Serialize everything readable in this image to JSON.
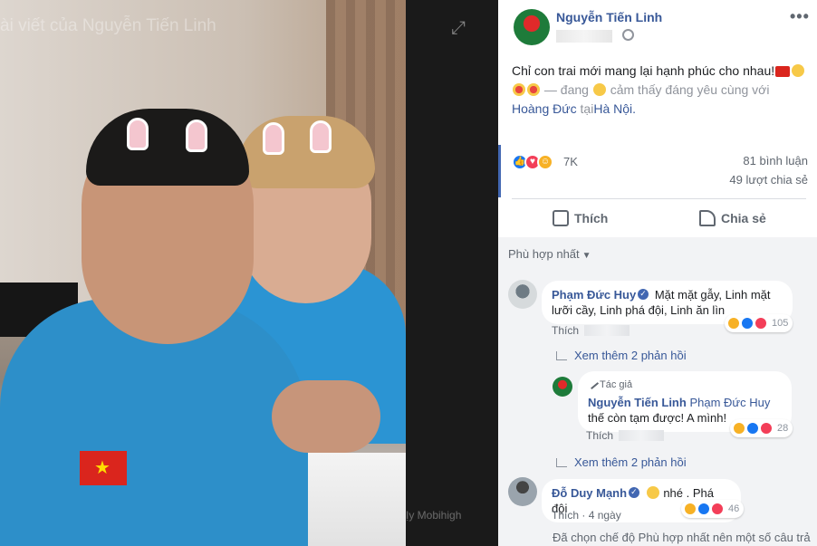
{
  "photo": {
    "overlay_title": "ài viết của Nguyễn Tiến Linh",
    "watermark": "Ịy Mobihigh"
  },
  "post": {
    "author": "Nguyễn Tiến Linh",
    "text_line1": "Chỉ con trai mới mang lại hạnh phúc cho nhau!",
    "feeling_prefix": "— đang",
    "feeling_text": "cảm thấy đáng yêu cùng với",
    "tagged_user": "Hoàng Đức",
    "location_prefix": "tại",
    "location": "Hà Nội.",
    "reaction_count": "7K",
    "comments": "81 bình luận",
    "shares": "49 lượt chia sẻ",
    "like_label": "Thích",
    "share_label": "Chia sẻ",
    "sort_label": "Phù hợp nhất"
  },
  "comments": [
    {
      "name": "Phạm Đức Huy",
      "text": "Mặt mặt gẫy, Linh mặt lưỡi cầy, Linh phá đội, Linh ăn lìn",
      "like_label": "Thích",
      "reactions": "105",
      "more_replies": "Xem thêm 2 phản hồi"
    },
    {
      "author_tag": "Tác giả",
      "name": "Nguyễn Tiến Linh",
      "mention": "Phạm Đức Huy",
      "text": "thế còn tạm được! A mình!",
      "like_label": "Thích",
      "reactions": "28",
      "more_replies": "Xem thêm 2 phản hồi"
    },
    {
      "name": "Đỗ Duy Mạnh",
      "text": "nhé . Phá đội",
      "like_label": "Thích",
      "time": "4 ngày",
      "reactions": "46"
    }
  ],
  "notice": "Đã chọn chế độ Phù hợp nhất nên một số câu trả",
  "icons": [
    "expand-icon",
    "globe-icon",
    "more-icon",
    "like-icon",
    "share-icon",
    "verified-icon",
    "pen-icon"
  ],
  "colors": {
    "link": "#385898",
    "like_blue": "#1877f2",
    "love_red": "#f33e58",
    "haha_yellow": "#f7b125",
    "comments_bg": "#f2f3f5"
  }
}
